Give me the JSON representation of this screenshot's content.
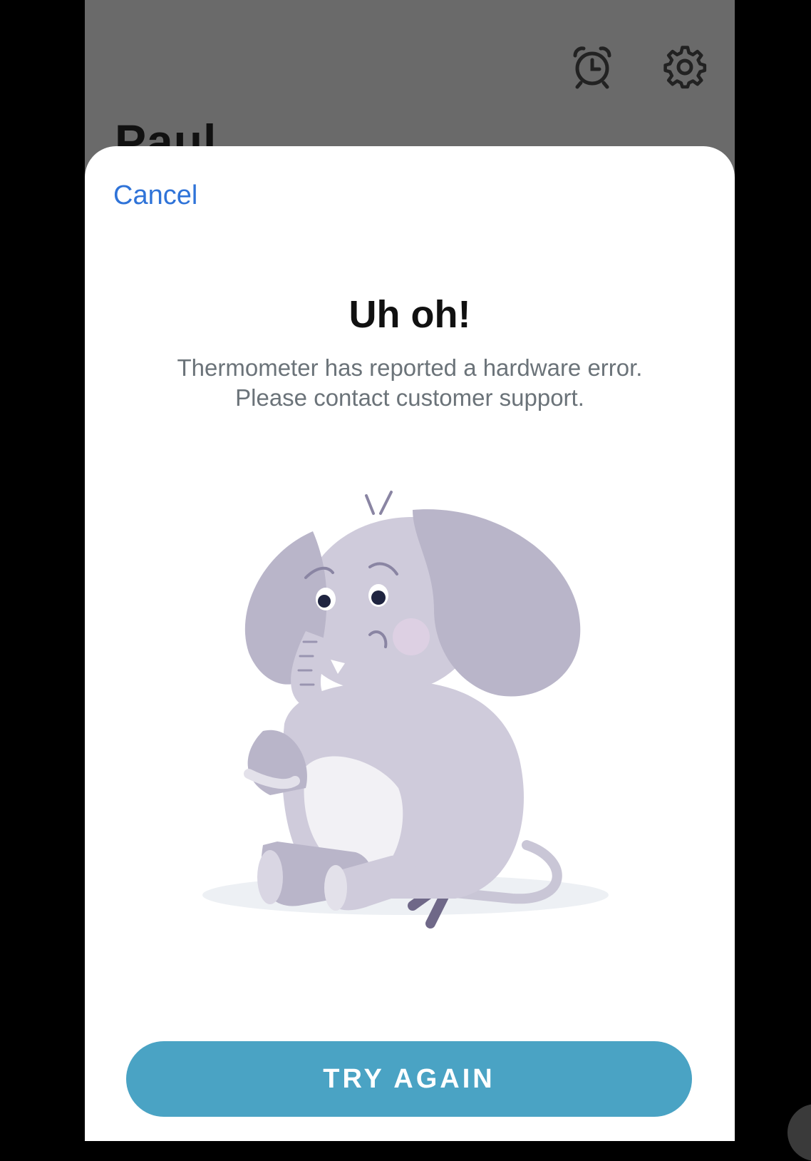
{
  "background": {
    "profile_name": "Paul",
    "icons": [
      "alarm-clock-icon",
      "gear-icon"
    ]
  },
  "sheet": {
    "cancel_label": "Cancel",
    "title": "Uh oh!",
    "message_line1": "Thermometer has reported a hardware error.",
    "message_line2": "Please contact customer support.",
    "illustration": "sad-elephant",
    "button_label": "TRY AGAIN"
  },
  "colors": {
    "link": "#2f73d8",
    "button": "#4aa3c4",
    "overlay": "#6a6a6a"
  }
}
